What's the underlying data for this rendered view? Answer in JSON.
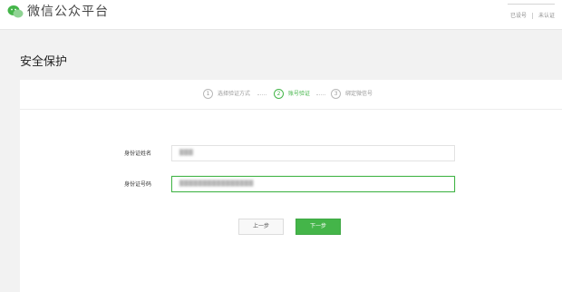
{
  "header": {
    "brand": "微信公众平台",
    "links": [
      "已设号",
      "未认证"
    ]
  },
  "page": {
    "title": "安全保护"
  },
  "steps": [
    {
      "num": "1",
      "label": "选择验证方式",
      "active": false
    },
    {
      "num": "2",
      "label": "账号验证",
      "active": true
    },
    {
      "num": "3",
      "label": "绑定微信号",
      "active": false
    }
  ],
  "form": {
    "name_label": "身份证姓名",
    "name_value": "███",
    "id_label": "身份证号码",
    "id_value": "████████████████"
  },
  "buttons": {
    "prev": "上一步",
    "next": "下一步"
  },
  "colors": {
    "accent": "#44b549",
    "page_bg": "#f2f2f2"
  },
  "icons": {
    "logo": "wechat-logo-icon"
  }
}
